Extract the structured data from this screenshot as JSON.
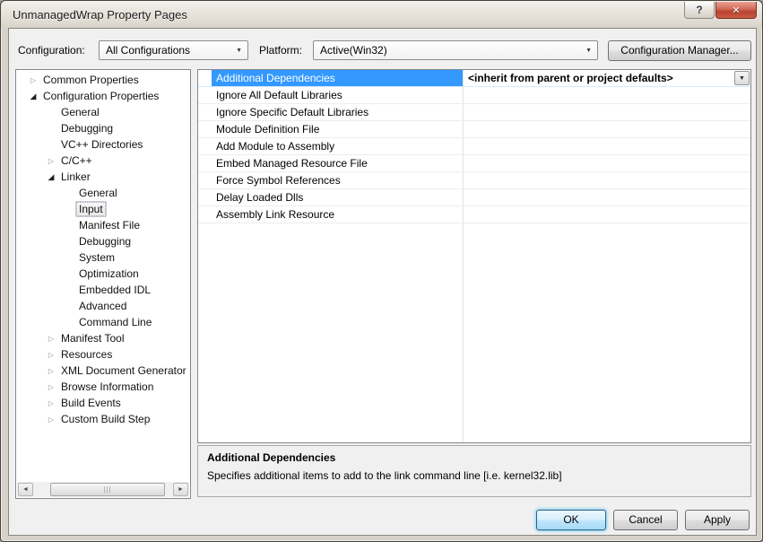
{
  "window": {
    "title": "UnmanagedWrap Property Pages",
    "help_glyph": "?",
    "close_glyph": "✕"
  },
  "toolbar": {
    "configuration_label": "Configuration:",
    "configuration_value": "All Configurations",
    "platform_label": "Platform:",
    "platform_value": "Active(Win32)",
    "configuration_manager_label": "Configuration Manager..."
  },
  "tree": {
    "items": [
      {
        "label": "Common Properties",
        "level": 0,
        "state": "collapsed",
        "selected": false
      },
      {
        "label": "Configuration Properties",
        "level": 0,
        "state": "expanded",
        "selected": false
      },
      {
        "label": "General",
        "level": 1,
        "state": "none",
        "selected": false
      },
      {
        "label": "Debugging",
        "level": 1,
        "state": "none",
        "selected": false
      },
      {
        "label": "VC++ Directories",
        "level": 1,
        "state": "none",
        "selected": false
      },
      {
        "label": "C/C++",
        "level": 1,
        "state": "collapsed",
        "selected": false
      },
      {
        "label": "Linker",
        "level": 1,
        "state": "expanded",
        "selected": false
      },
      {
        "label": "General",
        "level": 2,
        "state": "none",
        "selected": false
      },
      {
        "label": "Input",
        "level": 2,
        "state": "none",
        "selected": true
      },
      {
        "label": "Manifest File",
        "level": 2,
        "state": "none",
        "selected": false
      },
      {
        "label": "Debugging",
        "level": 2,
        "state": "none",
        "selected": false
      },
      {
        "label": "System",
        "level": 2,
        "state": "none",
        "selected": false
      },
      {
        "label": "Optimization",
        "level": 2,
        "state": "none",
        "selected": false
      },
      {
        "label": "Embedded IDL",
        "level": 2,
        "state": "none",
        "selected": false
      },
      {
        "label": "Advanced",
        "level": 2,
        "state": "none",
        "selected": false
      },
      {
        "label": "Command Line",
        "level": 2,
        "state": "none",
        "selected": false
      },
      {
        "label": "Manifest Tool",
        "level": 1,
        "state": "collapsed",
        "selected": false
      },
      {
        "label": "Resources",
        "level": 1,
        "state": "collapsed",
        "selected": false
      },
      {
        "label": "XML Document Generator",
        "level": 1,
        "state": "collapsed",
        "selected": false
      },
      {
        "label": "Browse Information",
        "level": 1,
        "state": "collapsed",
        "selected": false
      },
      {
        "label": "Build Events",
        "level": 1,
        "state": "collapsed",
        "selected": false
      },
      {
        "label": "Custom Build Step",
        "level": 1,
        "state": "collapsed",
        "selected": false
      }
    ]
  },
  "grid": {
    "rows": [
      {
        "name": "Additional Dependencies",
        "value": "<inherit from parent or project defaults>",
        "selected": true,
        "has_dropdown": true
      },
      {
        "name": "Ignore All Default Libraries",
        "value": "",
        "selected": false,
        "has_dropdown": false
      },
      {
        "name": "Ignore Specific Default Libraries",
        "value": "",
        "selected": false,
        "has_dropdown": false
      },
      {
        "name": "Module Definition File",
        "value": "",
        "selected": false,
        "has_dropdown": false
      },
      {
        "name": "Add Module to Assembly",
        "value": "",
        "selected": false,
        "has_dropdown": false
      },
      {
        "name": "Embed Managed Resource File",
        "value": "",
        "selected": false,
        "has_dropdown": false
      },
      {
        "name": "Force Symbol References",
        "value": "",
        "selected": false,
        "has_dropdown": false
      },
      {
        "name": "Delay Loaded Dlls",
        "value": "",
        "selected": false,
        "has_dropdown": false
      },
      {
        "name": "Assembly Link Resource",
        "value": "",
        "selected": false,
        "has_dropdown": false
      }
    ]
  },
  "description": {
    "title": "Additional Dependencies",
    "text": "Specifies additional items to add to the link command line [i.e. kernel32.lib]"
  },
  "buttons": {
    "ok": "OK",
    "cancel": "Cancel",
    "apply": "Apply"
  },
  "colors": {
    "selection_blue": "#3399FF",
    "close_button_red": "#BA4433",
    "default_button_glow": "#7ED0F2",
    "dialog_background": "#F0F0F0",
    "frame_beige": "#D6D2C9"
  }
}
